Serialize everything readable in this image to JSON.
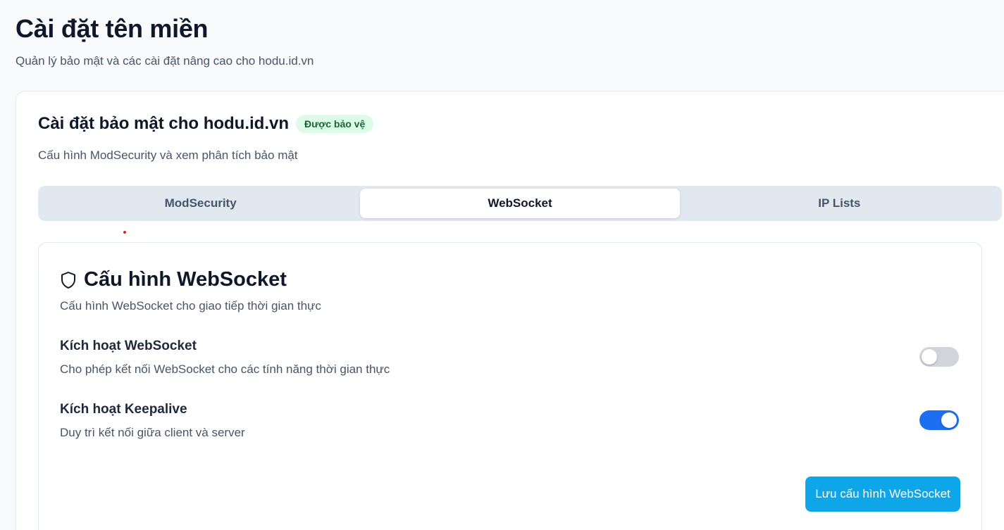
{
  "header": {
    "title": "Cài đặt tên miền",
    "subtitle": "Quản lý bảo mật và các cài đặt nâng cao cho hodu.id.vn"
  },
  "card": {
    "title": "Cài đặt bảo mật cho hodu.id.vn",
    "badge": "Được bảo vệ",
    "description": "Cấu hình ModSecurity và xem phân tích bảo mật",
    "badge_color": "#dcfce7"
  },
  "tabs": [
    {
      "label": "ModSecurity",
      "active": false
    },
    {
      "label": "WebSocket",
      "active": true
    },
    {
      "label": "IP Lists",
      "active": false
    }
  ],
  "panel": {
    "icon": "shield-icon",
    "title": "Cấu hình WebSocket",
    "description": "Cấu hình WebSocket cho giao tiếp thời gian thực",
    "settings": [
      {
        "label": "Kích hoạt WebSocket",
        "description": "Cho phép kết nối WebSocket cho các tính năng thời gian thực",
        "enabled": false
      },
      {
        "label": "Kích hoạt Keepalive",
        "description": "Duy trì kết nối giữa client và server",
        "enabled": true
      }
    ],
    "save_label": "Lưu cấu hình WebSocket"
  },
  "colors": {
    "accent": "#0ea5e9",
    "toggle_on": "#1d6ff2",
    "toggle_off": "#d1d5db"
  }
}
